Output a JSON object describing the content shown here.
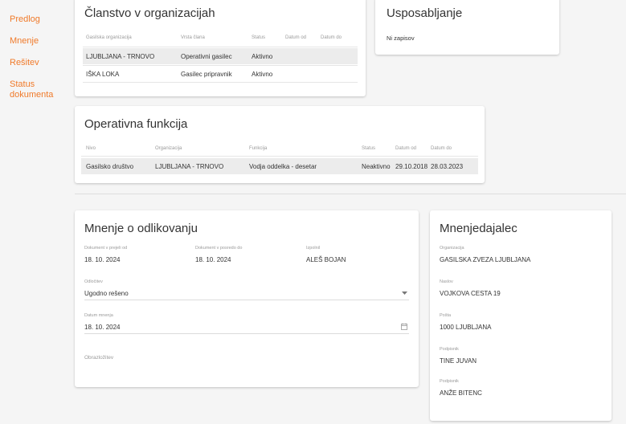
{
  "nav": {
    "items": [
      "Predlog",
      "Mnenje",
      "Rešitev",
      "Status dokumenta"
    ]
  },
  "membership": {
    "title": "Članstvo v organizacijah",
    "headers": [
      "Gasilska organizacija",
      "Vrsta člana",
      "Status",
      "Datum od",
      "Datum do"
    ],
    "rows": [
      [
        "LJUBLJANA - TRNOVO",
        "Operativni gasilec",
        "Aktivno",
        "",
        ""
      ],
      [
        "IŠKA LOKA",
        "Gasilec pripravnik",
        "Aktivno",
        "",
        ""
      ]
    ]
  },
  "training": {
    "title": "Usposabljanje",
    "empty_text": "Ni zapisov"
  },
  "operational": {
    "title": "Operativna funkcija",
    "headers": [
      "Nivo",
      "Organizacija",
      "Funkcija",
      "Status",
      "Datum od",
      "Datum do"
    ],
    "rows": [
      [
        "Gasilsko društvo",
        "LJUBLJANA - TRNOVO",
        "Vodja oddelka - desetar",
        "Neaktivno",
        "29.10.2018",
        "28.03.2023"
      ]
    ]
  },
  "opinion": {
    "title": "Mnenje o odlikovanju",
    "fields": {
      "received": {
        "label": "Dokument v prejeli od",
        "value": "18. 10. 2024"
      },
      "sent": {
        "label": "Dokument v posredo do",
        "value": "18. 10. 2024"
      },
      "editor": {
        "label": "Izpolnil",
        "value": "ALEŠ BOJAN"
      },
      "decision": {
        "label": "Odločitev",
        "value": "Ugodno rešeno"
      },
      "date": {
        "label": "Datum mnenja",
        "value": "18. 10. 2024"
      },
      "notes": {
        "label": "Obrazložitev",
        "value": ""
      }
    }
  },
  "provider": {
    "title": "Mnenjedajalec",
    "fields": [
      {
        "label": "Organizacija",
        "value": "GASILSKA ZVEZA LJUBLJANA"
      },
      {
        "label": "Naslov",
        "value": "VOJKOVA CESTA 19"
      },
      {
        "label": "Pošta",
        "value": "1000 LJUBLJANA"
      },
      {
        "label": "Podpisnik",
        "value": "TINE JUVAN"
      },
      {
        "label": "Podpisnik",
        "value": "ANŽE BITENC"
      }
    ]
  },
  "icons": {
    "dropdown": "chevron-down-icon",
    "calendar": "calendar-icon"
  },
  "colors": {
    "accent": "#f07a2a",
    "background": "#f5f5f5",
    "card": "#ffffff"
  }
}
